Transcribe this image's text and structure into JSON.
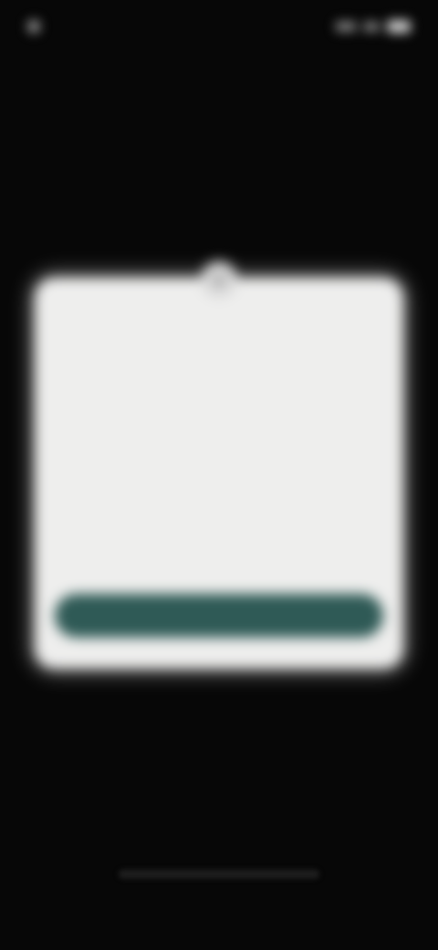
{
  "status_bar": {
    "time": "",
    "icons": [
      "signal-icon",
      "wifi-icon",
      "battery-icon"
    ]
  },
  "modal": {
    "badge_icon": "info-icon",
    "title": "",
    "body": "",
    "link_text": "",
    "primary_button_label": ""
  },
  "colors": {
    "background": "#070707",
    "modal_surface": "#eeeeed",
    "primary_button": "#2f5a56"
  }
}
